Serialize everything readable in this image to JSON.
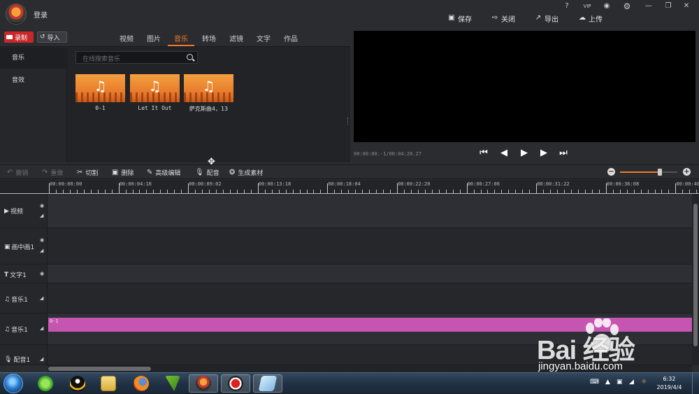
{
  "titlebar": {
    "login": "登录",
    "system_icons": [
      "help-icon",
      "vip-icon",
      "bell-icon",
      "gear-icon",
      "minimize-icon",
      "restore-icon",
      "close-icon"
    ],
    "help": "?",
    "vip": "VIP",
    "save": "保存",
    "close": "关闭",
    "export": "导出",
    "upload": "上传"
  },
  "media": {
    "record": "录制",
    "import": "导入",
    "tabs": [
      "视频",
      "图片",
      "音乐",
      "转场",
      "滤镜",
      "文字",
      "作品"
    ],
    "active_tab": "音乐",
    "categories": [
      "音乐",
      "音效"
    ],
    "search_placeholder": "在线搜索音乐",
    "items": [
      "0-1",
      "Let It Out",
      "萨克斯曲4，13"
    ]
  },
  "preview": {
    "time": "00:00:00.-1/00:04:20.27"
  },
  "toolbar": {
    "undo": "撤销",
    "redo": "重做",
    "cut": "切割",
    "delete": "删除",
    "advanced": "高级编辑",
    "dub": "配音",
    "generate": "生成素材",
    "zoom_level": 0.7
  },
  "ruler": [
    "00:00:00:00",
    "00:00:04:16",
    "00:00:09:02",
    "00:00:13:18",
    "00:00:18:04",
    "00:00:22:20",
    "00:00:27:06",
    "00:00:31:22",
    "00:00:36:08",
    "00:00:40"
  ],
  "tracks": {
    "video": "视频",
    "pip": "画中画1",
    "text": "文字1",
    "music1": "音乐1",
    "music2": "音乐1",
    "dub": "配音1",
    "clip_label": "0-1"
  },
  "taskbar": {
    "time": "6:32",
    "date": "2019/4/4"
  },
  "watermark": {
    "brand": "Bai  经验",
    "url": "jingyan.baidu.com"
  },
  "colors": {
    "accent": "#f07a2a",
    "record": "#c8282a",
    "clip": "#c655b2",
    "panel": "#2b2c30"
  }
}
